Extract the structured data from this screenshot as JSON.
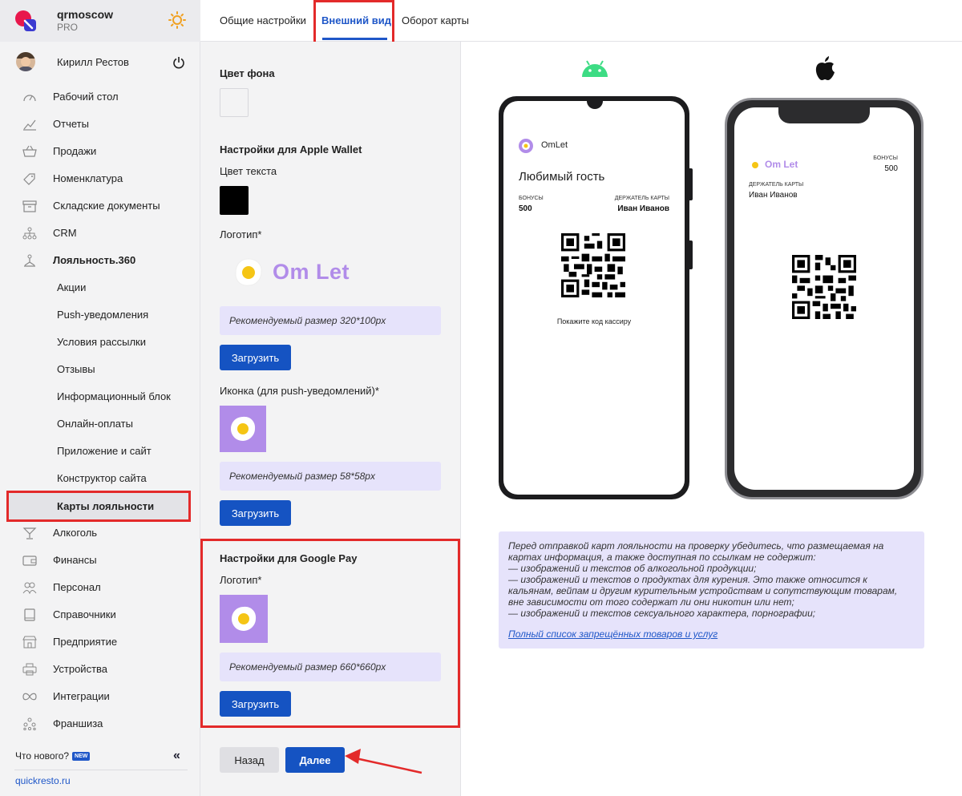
{
  "org": {
    "name": "qrmoscow",
    "plan": "PRO"
  },
  "user": {
    "name": "Кирилл Рестов"
  },
  "nav": [
    {
      "label": "Рабочий стол",
      "icon": "dashboard-icon"
    },
    {
      "label": "Отчеты",
      "icon": "chart-icon"
    },
    {
      "label": "Продажи",
      "icon": "basket-icon"
    },
    {
      "label": "Номенклатура",
      "icon": "tag-icon"
    },
    {
      "label": "Складские документы",
      "icon": "archive-icon"
    },
    {
      "label": "CRM",
      "icon": "hierarchy-icon"
    },
    {
      "label": "Лояльность.360",
      "icon": "loyalty-icon"
    },
    {
      "label": "Акции"
    },
    {
      "label": "Push-уведомления"
    },
    {
      "label": "Условия рассылки"
    },
    {
      "label": "Отзывы"
    },
    {
      "label": "Информационный блок"
    },
    {
      "label": "Онлайн-оплаты"
    },
    {
      "label": "Приложение и сайт"
    },
    {
      "label": "Конструктор сайта"
    },
    {
      "label": "Карты лояльности"
    },
    {
      "label": "Алкоголь",
      "icon": "cocktail-icon"
    },
    {
      "label": "Финансы",
      "icon": "wallet-icon"
    },
    {
      "label": "Персонал",
      "icon": "people-icon"
    },
    {
      "label": "Справочники",
      "icon": "book-icon"
    },
    {
      "label": "Предприятие",
      "icon": "store-icon"
    },
    {
      "label": "Устройства",
      "icon": "printer-icon"
    },
    {
      "label": "Интеграции",
      "icon": "infinity-icon"
    },
    {
      "label": "Франшиза",
      "icon": "franchise-icon"
    }
  ],
  "whats_new": "Что нового?",
  "new_badge": "NEW",
  "collapse": "«",
  "site_link": "quickresto.ru",
  "tabs": [
    "Общие настройки",
    "Внешний вид",
    "Оборот карты"
  ],
  "settings": {
    "bg_color_label": "Цвет фона",
    "bg_color": "#ffffff",
    "apple_header": "Настройки для Apple Wallet",
    "text_color_label": "Цвет текста",
    "text_color": "#000000",
    "logo_label": "Логотип*",
    "logo_hint": "Рекомендуемый размер 320*100px",
    "upload": "Загрузить",
    "icon_label": "Иконка (для push-уведомлений)*",
    "icon_hint": "Рекомендуемый размер 58*58px",
    "google_header": "Настройки для Google Pay",
    "google_logo_label": "Логотип*",
    "google_hint": "Рекомендуемый размер 660*660px",
    "back": "Назад",
    "next": "Далее"
  },
  "brand_logo_text": "Om Let",
  "android_card": {
    "brand": "OmLet",
    "title": "Любимый гость",
    "bonus_label": "БОНУСЫ",
    "bonus_value": "500",
    "holder_label": "ДЕРЖАТЕЛЬ КАРТЫ",
    "holder_value": "Иван Иванов",
    "caption": "Покажите код кассиру"
  },
  "apple_card": {
    "bonus_label": "БОНУСЫ",
    "bonus_value": "500",
    "holder_label": "ДЕРЖАТЕЛЬ КАРТЫ",
    "holder_value": "Иван Иванов"
  },
  "notice": {
    "text": "Перед отправкой карт лояльности на проверку убедитесь, что размещаемая на картах информация, а также доступная по ссылкам не содержит:\n— изображений и текстов об алкогольной продукции;\n— изображений и текстов о продуктах для курения. Это также относится к кальянам, вейпам и другим курительным устройствам и сопутствующим товарам, вне зависимости от того содержат ли они никотин или нет;\n— изображений и текстов сексуального характера, порнографии;",
    "link": "Полный список запрещённых товаров и услуг"
  },
  "colors": {
    "accent": "#1553c2",
    "highlight": "#e32a2a",
    "lavender": "#b18ce9",
    "hint_bg": "#e6e3fb"
  }
}
